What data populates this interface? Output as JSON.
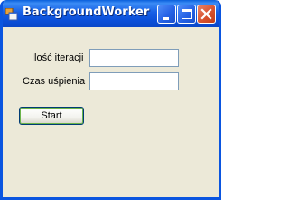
{
  "window": {
    "title": "BackgroundWorker",
    "icon": "app-window-icon",
    "controls": {
      "minimize": "minimize-icon",
      "maximize": "maximize-icon",
      "close": "close-icon"
    }
  },
  "form": {
    "iterations_label": "Ilość iteracji",
    "iterations_value": "",
    "sleep_label": "Czas uśpienia",
    "sleep_value": "",
    "start_label": "Start"
  },
  "colors": {
    "titlebar": "#0a5fdc",
    "client_background": "#ece9d8",
    "close_button": "#d8532f",
    "button_focus": "#6bb44a"
  }
}
